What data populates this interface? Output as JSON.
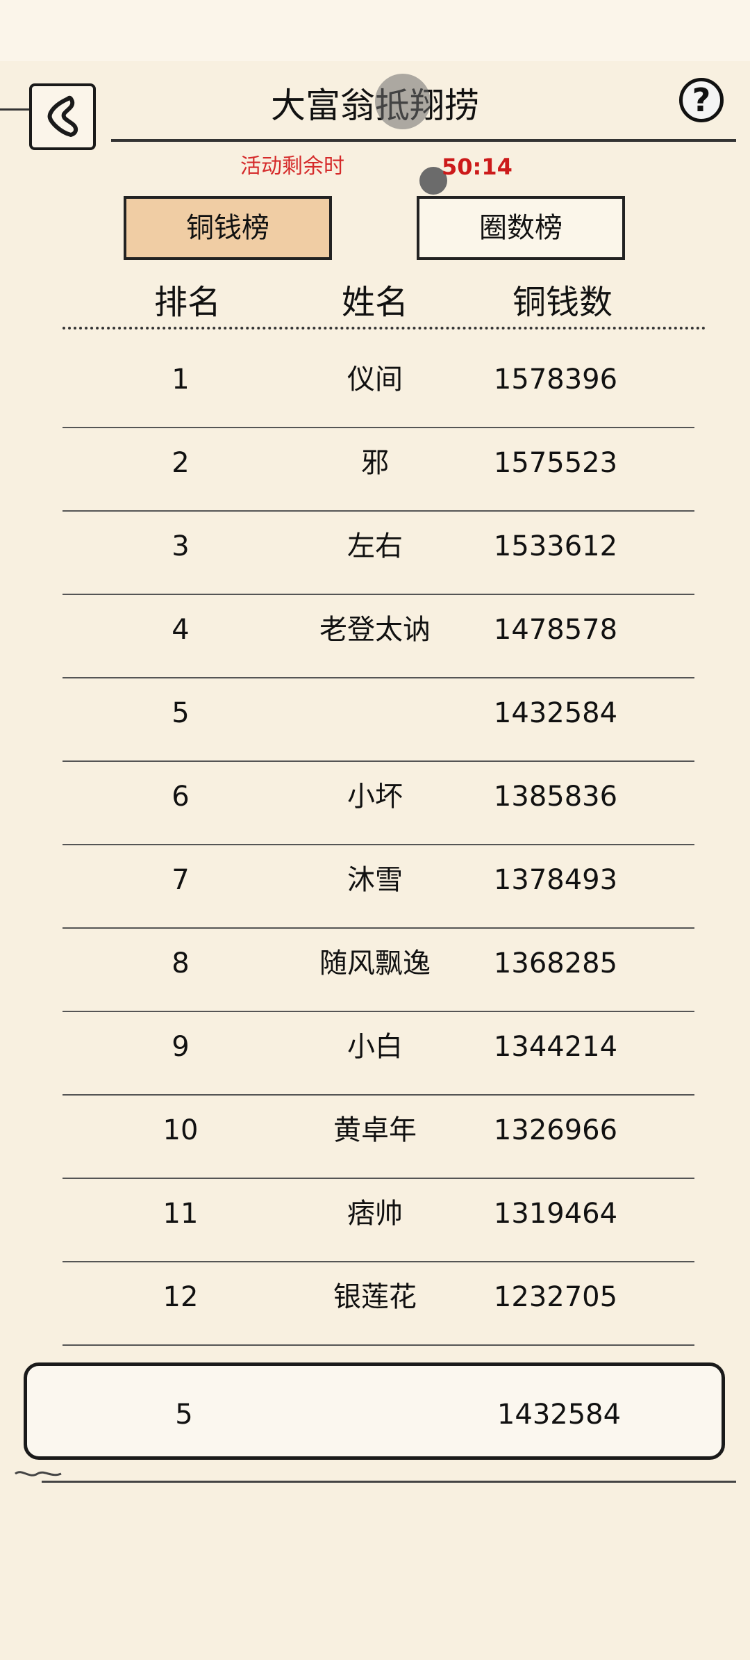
{
  "header": {
    "title": "大富翁抵翔捞"
  },
  "help": {
    "label": "?"
  },
  "timer": {
    "label": "活动剩余时",
    "value": "50:14"
  },
  "tabs": [
    {
      "label": "铜钱榜",
      "active": true
    },
    {
      "label": "圈数榜",
      "active": false
    }
  ],
  "columns": {
    "rank": "排名",
    "name": "姓名",
    "coins": "铜钱数"
  },
  "rows": [
    {
      "rank": "1",
      "name": "仪间",
      "coins": "1578396"
    },
    {
      "rank": "2",
      "name": "邪",
      "coins": "1575523"
    },
    {
      "rank": "3",
      "name": "左右",
      "coins": "1533612"
    },
    {
      "rank": "4",
      "name": "老登太讷",
      "coins": "1478578"
    },
    {
      "rank": "5",
      "name": "",
      "coins": "1432584"
    },
    {
      "rank": "6",
      "name": "小坏",
      "coins": "1385836"
    },
    {
      "rank": "7",
      "name": "沐雪",
      "coins": "1378493"
    },
    {
      "rank": "8",
      "name": "随风飘逸",
      "coins": "1368285"
    },
    {
      "rank": "9",
      "name": "小白",
      "coins": "1344214"
    },
    {
      "rank": "10",
      "name": "黄卓年",
      "coins": "1326966"
    },
    {
      "rank": "11",
      "name": "痞帅",
      "coins": "1319464"
    },
    {
      "rank": "12",
      "name": "银莲花",
      "coins": "1232705"
    }
  ],
  "self": {
    "rank": "5",
    "name": "",
    "coins": "1432584"
  },
  "colors": {
    "background": "#f8f0e0",
    "active_tab": "#f0cda4",
    "timer": "#cc1a1a"
  }
}
